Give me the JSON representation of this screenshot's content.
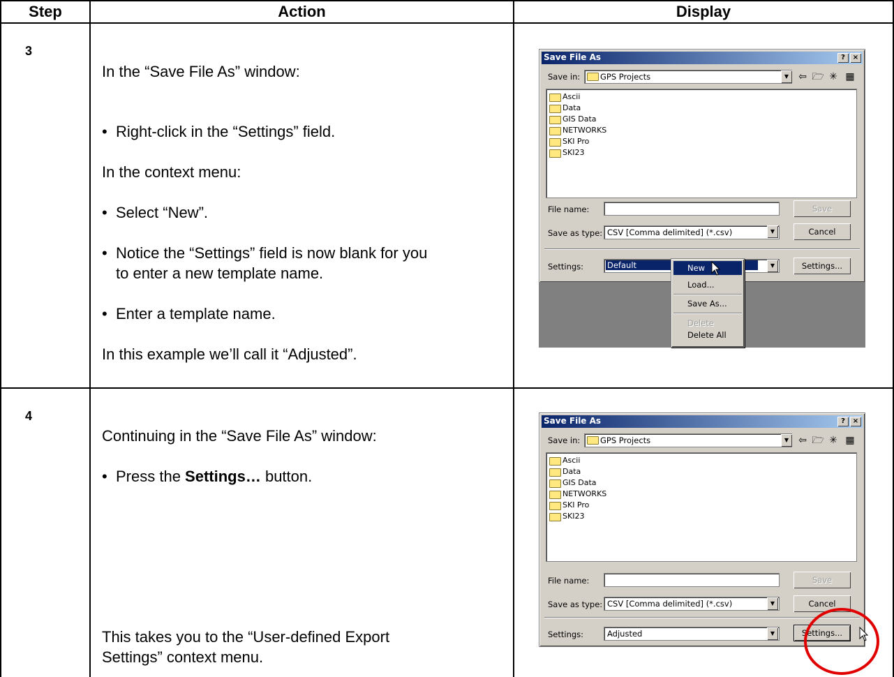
{
  "table": {
    "headers": {
      "step": "Step",
      "action": "Action",
      "display": "Display"
    }
  },
  "rows": [
    {
      "step": "3",
      "lines": [
        "In the “Save File As” window:",
        "Right-click in the “Settings” field.",
        "In the context menu:",
        "Select “New”.",
        "Notice the “Settings” field is now blank for you",
        "to enter a new template name.",
        "Enter a template name.",
        "In this example we’ll call it “Adjusted”."
      ],
      "dialog": {
        "title": "Save File As",
        "help_btn": "?",
        "close_btn": "×",
        "save_in_label": "Save in:",
        "save_in_value": "GPS Projects",
        "folders": [
          "Ascii",
          "Data",
          "GIS Data",
          "NETWORKS",
          "SKI Pro",
          "SKI23"
        ],
        "file_name_label": "File name:",
        "file_name_value": "",
        "save_as_type_label": "Save as type:",
        "save_as_type_value": "CSV [Comma delimited] (*.csv)",
        "settings_label": "Settings:",
        "settings_value": "Default",
        "save_btn": "Save",
        "cancel_btn": "Cancel",
        "settings_btn": "Settings..."
      },
      "context_menu": {
        "items": [
          "New",
          "Load...",
          "Save As...",
          "Delete",
          "Delete All"
        ],
        "selected": "New",
        "disabled": [
          "Delete"
        ]
      }
    },
    {
      "step": "4",
      "lines": [
        "Continuing in the “Save File As” window:",
        "Press the ",
        "Settings…",
        " button.",
        "This takes you to the “User-defined Export",
        "Settings” context menu."
      ],
      "dialog": {
        "title": "Save File As",
        "help_btn": "?",
        "close_btn": "×",
        "save_in_label": "Save in:",
        "save_in_value": "GPS Projects",
        "folders": [
          "Ascii",
          "Data",
          "GIS Data",
          "NETWORKS",
          "SKI Pro",
          "SKI23"
        ],
        "file_name_label": "File name:",
        "file_name_value": "",
        "save_as_type_label": "Save as type:",
        "save_as_type_value": "CSV [Comma delimited] (*.csv)",
        "settings_label": "Settings:",
        "settings_value": "Adjusted",
        "save_btn": "Save",
        "cancel_btn": "Cancel",
        "settings_btn": "Settings..."
      }
    }
  ],
  "colors": {
    "titlebar": "#0a246a",
    "highlight_circle": "#e00000",
    "dialog_face": "#d4d0c8"
  }
}
